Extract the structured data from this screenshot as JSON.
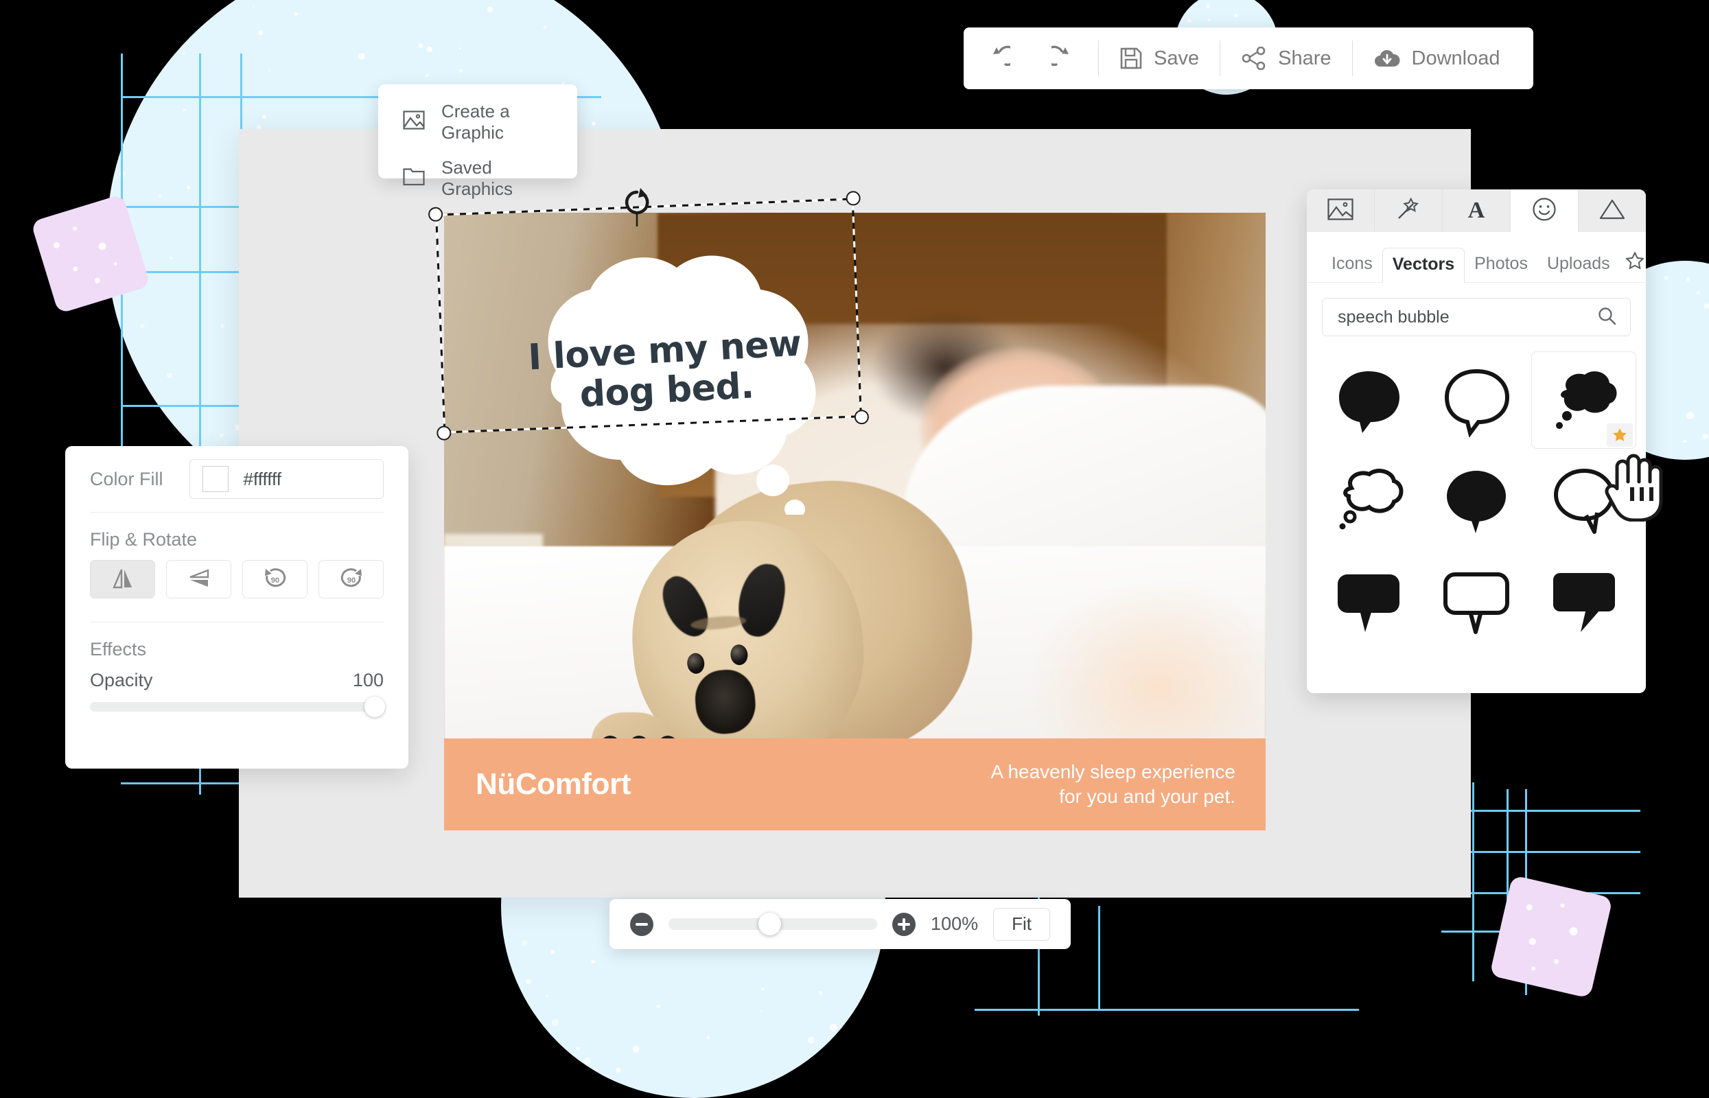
{
  "toolbar": {
    "undo_icon": "undo-icon",
    "redo_icon": "redo-icon",
    "save_label": "Save",
    "share_label": "Share",
    "download_label": "Download"
  },
  "dropdown": {
    "items": [
      {
        "label": "Create a Graphic",
        "icon": "image-icon"
      },
      {
        "label": "Saved Graphics",
        "icon": "folder-icon"
      }
    ]
  },
  "properties": {
    "color_fill_label": "Color Fill",
    "color_value": "#ffffff",
    "flip_rotate_label": "Flip & Rotate",
    "buttons": [
      {
        "name": "flip-horizontal",
        "active": true
      },
      {
        "name": "flip-vertical",
        "active": false
      },
      {
        "name": "rotate-left-90",
        "label": "90",
        "active": false
      },
      {
        "name": "rotate-right-90",
        "label": "90",
        "active": false
      }
    ],
    "effects_label": "Effects",
    "opacity_label": "Opacity",
    "opacity_value": "100"
  },
  "assets": {
    "top_tabs": [
      {
        "name": "photos-tab",
        "icon": "image-icon",
        "active": false
      },
      {
        "name": "effects-tab",
        "icon": "magic-wand-icon",
        "active": false
      },
      {
        "name": "text-tab",
        "icon": "letter-a-icon",
        "active": false
      },
      {
        "name": "graphics-tab",
        "icon": "smiley-icon",
        "active": true
      },
      {
        "name": "shapes-tab",
        "icon": "triangle-icon",
        "active": false
      }
    ],
    "sub_tabs": [
      {
        "label": "Icons",
        "active": false
      },
      {
        "label": "Vectors",
        "active": true
      },
      {
        "label": "Photos",
        "active": false
      },
      {
        "label": "Uploads",
        "active": false
      }
    ],
    "favorites_icon": "star-outline-icon",
    "search": {
      "value": "speech bubble",
      "placeholder": "Search",
      "icon": "search-icon"
    },
    "results": [
      {
        "name": "bubble-round-filled",
        "style": "filled",
        "shape": "round"
      },
      {
        "name": "bubble-round-outline",
        "style": "outline",
        "shape": "round"
      },
      {
        "name": "bubble-cloud-filled",
        "style": "filled",
        "shape": "cloud",
        "highlighted": true,
        "favorite_badge": "star-filled-icon"
      },
      {
        "name": "bubble-cloud-outline",
        "style": "outline",
        "shape": "cloud"
      },
      {
        "name": "bubble-drop-filled",
        "style": "filled",
        "shape": "drop"
      },
      {
        "name": "bubble-drop-outline",
        "style": "outline",
        "shape": "drop"
      },
      {
        "name": "bubble-rect-filled",
        "style": "filled",
        "shape": "rect"
      },
      {
        "name": "bubble-rect-outline",
        "style": "outline",
        "shape": "rect"
      },
      {
        "name": "bubble-rect-corner-filled",
        "style": "filled",
        "shape": "rect-corner"
      }
    ],
    "cursor": "hand-pointer-cursor"
  },
  "canvas": {
    "bubble_text_line1": "I love my new",
    "bubble_text_line2": "dog bed.",
    "brand": "NüComfort",
    "tagline_line1": "A heavenly sleep experience",
    "tagline_line2": "for you and your pet.",
    "footer_color": "#f5ab80",
    "rotate_handle_icon": "rotate-handle-icon"
  },
  "zoombar": {
    "minus_icon": "zoom-out-icon",
    "plus_icon": "zoom-in-icon",
    "percent": "100%",
    "fit_label": "Fit"
  }
}
